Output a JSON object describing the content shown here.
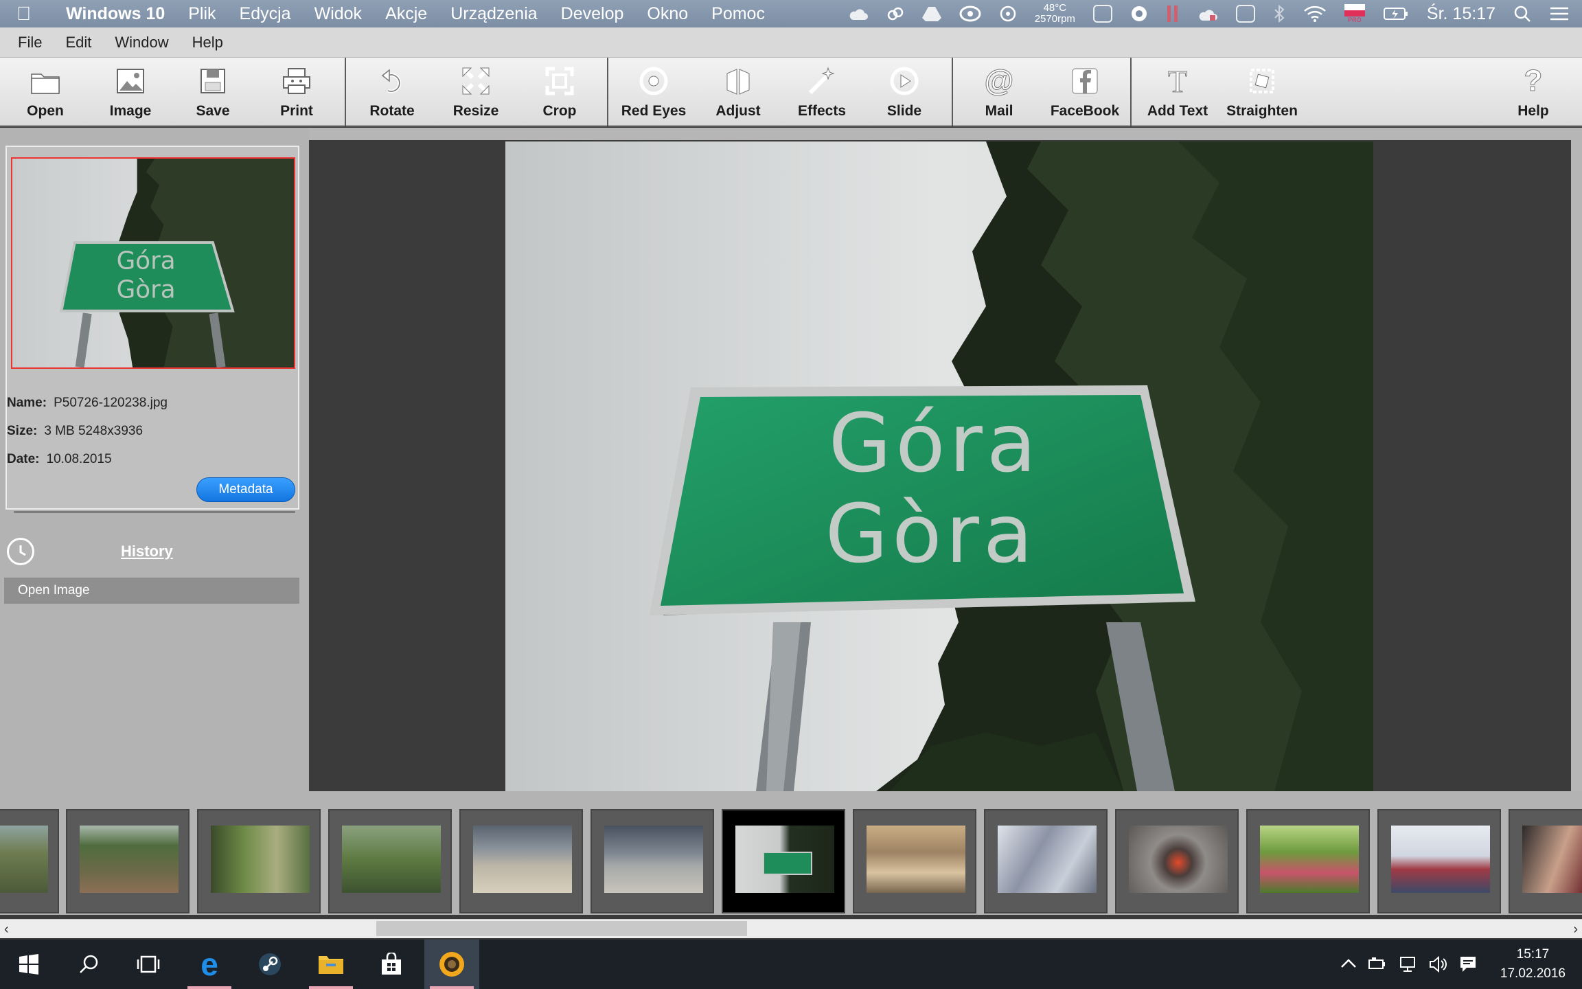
{
  "macbar": {
    "app_name": "Windows 10",
    "menus": [
      "Plik",
      "Edycja",
      "Widok",
      "Akcje",
      "Urządzenia",
      "Develop",
      "Okno",
      "Pomoc"
    ],
    "temp": "48°C",
    "rpm": "2570rpm",
    "flag_label": "PRO",
    "clock": "Śr. 15:17"
  },
  "appmenu": [
    "File",
    "Edit",
    "Window",
    "Help"
  ],
  "toolbar": {
    "open": "Open",
    "image": "Image",
    "save": "Save",
    "print": "Print",
    "rotate": "Rotate",
    "resize": "Resize",
    "crop": "Crop",
    "redeyes": "Red Eyes",
    "adjust": "Adjust",
    "effects": "Effects",
    "slide": "Slide",
    "mail": "Mail",
    "facebook": "FaceBook",
    "addtext": "Add Text",
    "straighten": "Straighten",
    "help": "Help"
  },
  "info": {
    "name_label": "Name:",
    "name": "P50726-120238.jpg",
    "size_label": "Size:",
    "size": "3 MB  5248x3936",
    "date_label": "Date:",
    "date": "10.08.2015",
    "metadata_button": "Metadata"
  },
  "history": {
    "title": "History",
    "items": [
      "Open Image"
    ]
  },
  "sign": {
    "line1": "Góra",
    "line2": "Gòra"
  },
  "taskbar": {
    "time": "15:17",
    "date": "17.02.2016"
  },
  "colors": {
    "sign_green": "#1f8d5a",
    "selection_red": "#ee3333",
    "metadata_blue": "#1f86f0"
  }
}
